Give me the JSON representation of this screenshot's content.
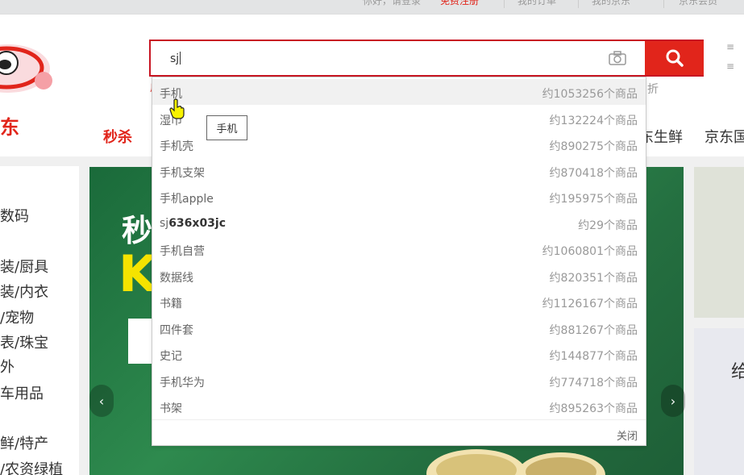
{
  "topbar": {
    "greeting": "你好，请登录",
    "register": "免费注册",
    "orders": "我的订单",
    "myjd": "我的京东",
    "member": "京东会员"
  },
  "logo": {
    "text": "东"
  },
  "search": {
    "value": "sj",
    "hint_left": "用",
    "hint_right": "折"
  },
  "right_col": {
    "icon": "≡"
  },
  "nav": {
    "seckill": "秒杀",
    "items": [
      "东生鲜",
      "京东国"
    ]
  },
  "categories": [
    "数码",
    "装/厨具",
    "装/内衣",
    "/宠物",
    "表/珠宝",
    "外",
    "车用品",
    "鲜/特产",
    "/农资绿植"
  ],
  "banner": {
    "t1": "秒",
    "t2": "K"
  },
  "side": {
    "bot_text": "给"
  },
  "suggestions": [
    {
      "word": "手机",
      "bold": "",
      "count": "约1053256个商品"
    },
    {
      "word": "湿巾",
      "bold": "",
      "count": "约132224个商品"
    },
    {
      "word": "手机壳",
      "bold": "",
      "count": "约890275个商品"
    },
    {
      "word": "手机支架",
      "bold": "",
      "count": "约870418个商品"
    },
    {
      "word": "手机apple",
      "bold": "",
      "count": "约195975个商品"
    },
    {
      "word": "sj",
      "bold": "636x03jc",
      "count": "约29个商品"
    },
    {
      "word": "手机自营",
      "bold": "",
      "count": "约1060801个商品"
    },
    {
      "word": "数据线",
      "bold": "",
      "count": "约820351个商品"
    },
    {
      "word": "书籍",
      "bold": "",
      "count": "约1126167个商品"
    },
    {
      "word": "四件套",
      "bold": "",
      "count": "约881267个商品"
    },
    {
      "word": "史记",
      "bold": "",
      "count": "约144877个商品"
    },
    {
      "word": "手机华为",
      "bold": "",
      "count": "约774718个商品"
    },
    {
      "word": "书架",
      "bold": "",
      "count": "约895263个商品"
    }
  ],
  "dropdown": {
    "close": "关闭"
  },
  "tooltip": "手机",
  "colors": {
    "accent": "#e1251b",
    "border": "#c81623"
  }
}
